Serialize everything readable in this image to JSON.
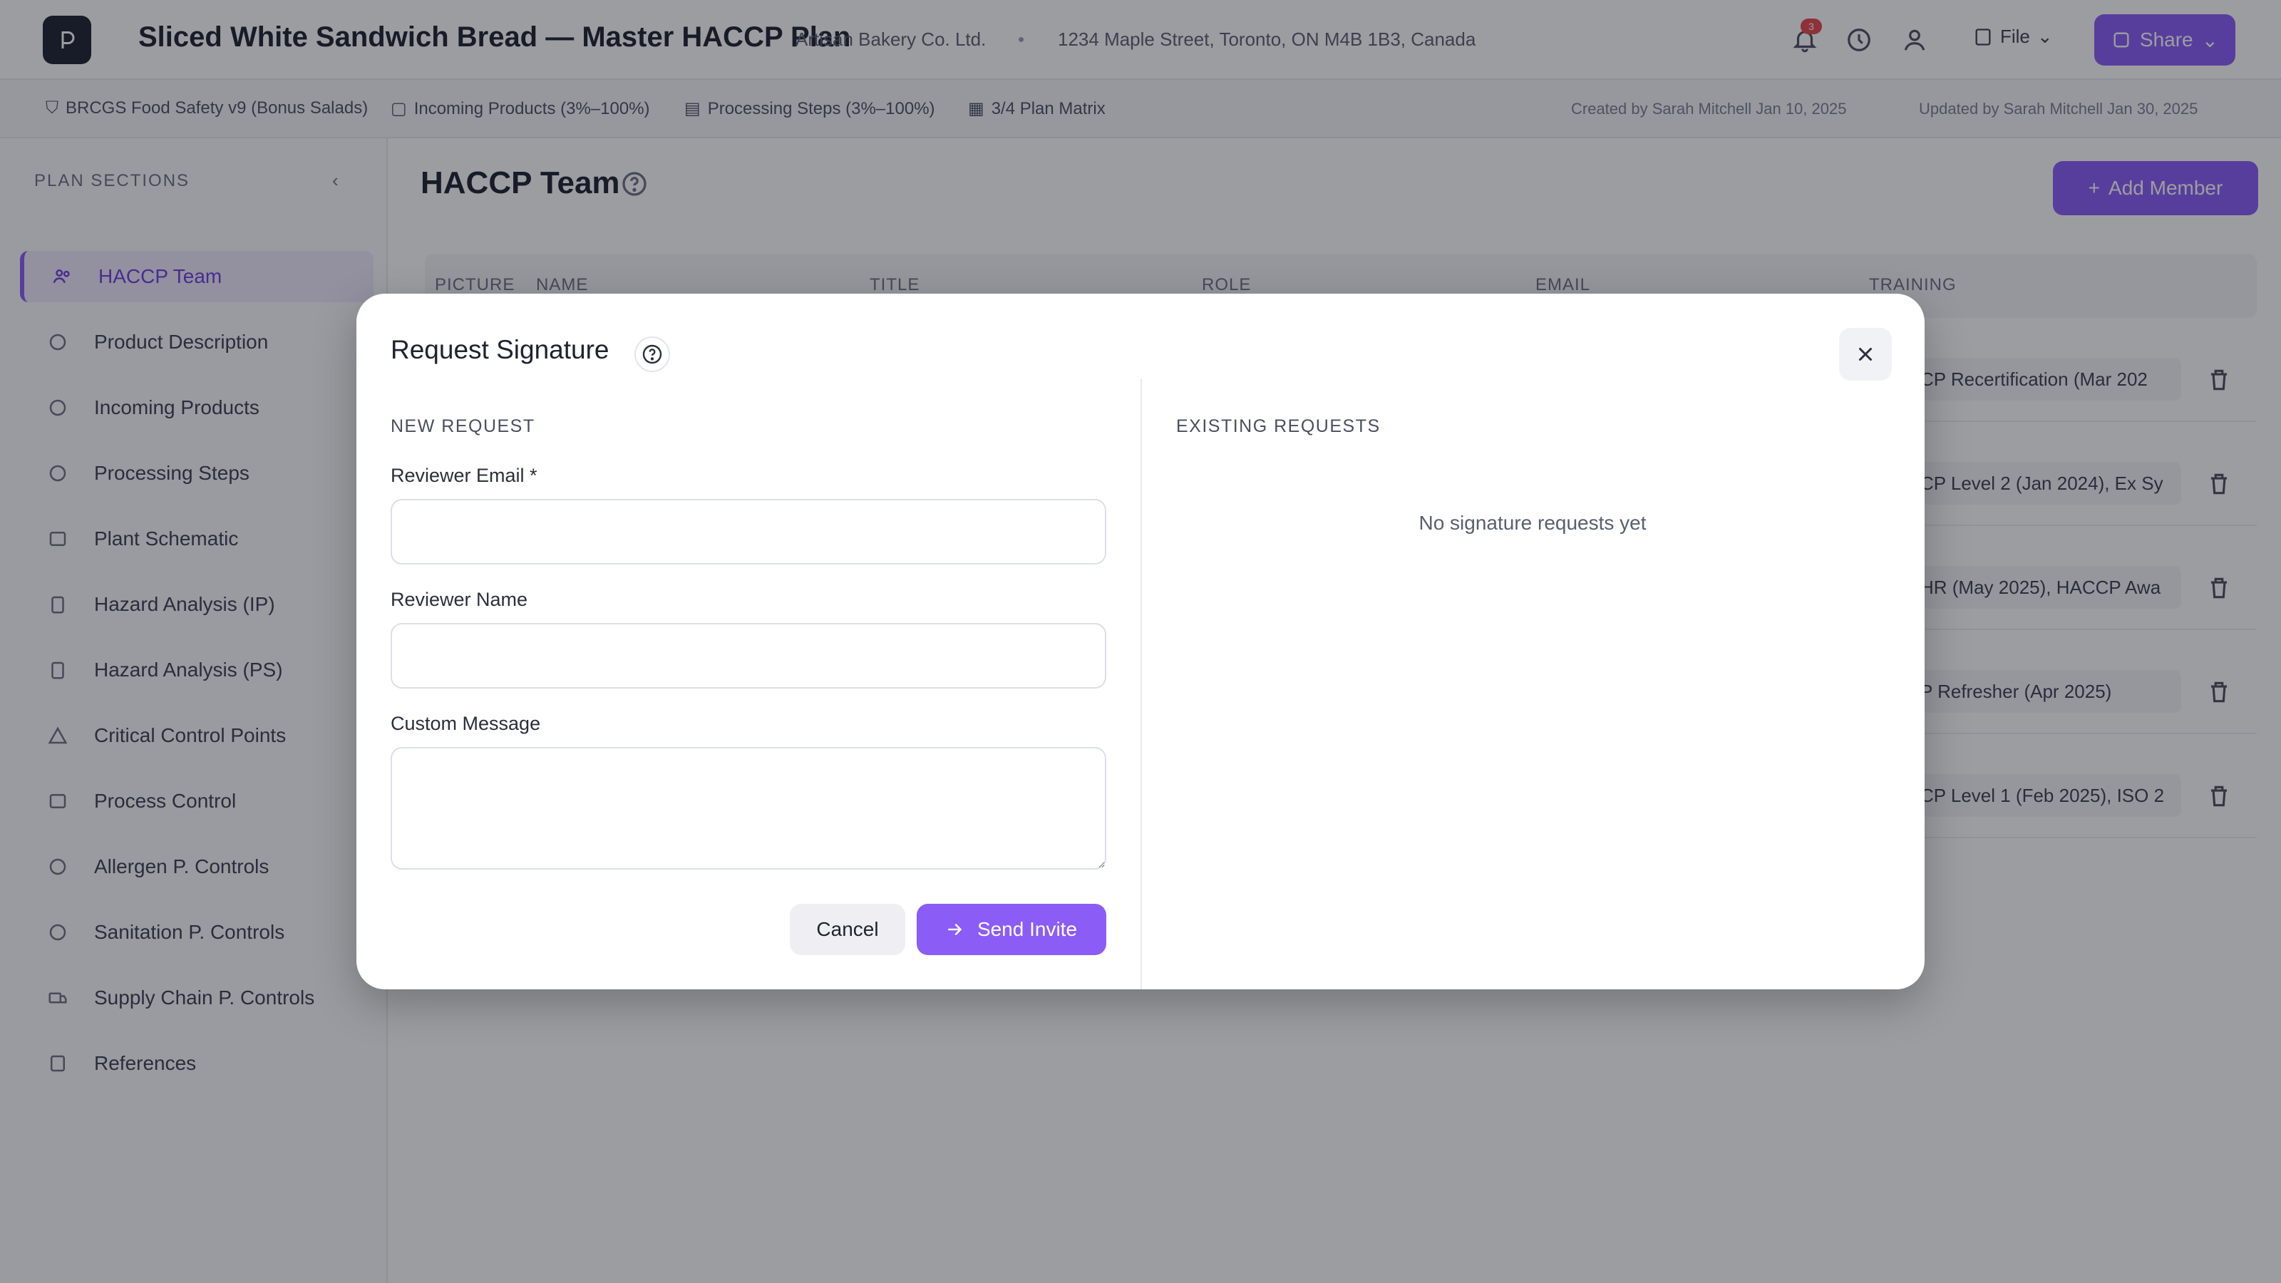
{
  "header": {
    "plan_title": "Sliced White Sandwich Bread — Master HACCP Plan",
    "company": "Artisan Bakery Co. Ltd.",
    "address": "1234 Maple Street, Toronto, ON M4B 1B3, Canada",
    "notification_count": "3",
    "file_menu_label": "File",
    "share_label": "Share"
  },
  "subbar": {
    "chips": [
      "BRCGS Food Safety v9 (Bonus Salads)",
      "Incoming Products (3%–100%)",
      "Processing Steps (3%–100%)",
      "3/4 Plan Matrix"
    ],
    "created": "Created by Sarah Mitchell Jan 10, 2025",
    "updated": "Updated by Sarah Mitchell Jan 30, 2025"
  },
  "sidebar": {
    "heading": "PLAN SECTIONS",
    "items": [
      {
        "label": "HACCP Team",
        "icon": "users-icon"
      },
      {
        "label": "Product Description",
        "icon": "product-icon"
      },
      {
        "label": "Incoming Products",
        "icon": "box-icon"
      },
      {
        "label": "Processing Steps",
        "icon": "steps-icon"
      },
      {
        "label": "Plant Schematic",
        "icon": "map-icon"
      },
      {
        "label": "Hazard Analysis (IP)",
        "icon": "clipboard-icon"
      },
      {
        "label": "Hazard Analysis (PS)",
        "icon": "clipboard-icon"
      },
      {
        "label": "Critical Control Points",
        "icon": "warning-icon"
      },
      {
        "label": "Process Control",
        "icon": "sliders-icon"
      },
      {
        "label": "Allergen P. Controls",
        "icon": "shield-icon"
      },
      {
        "label": "Sanitation P. Controls",
        "icon": "sparkle-icon"
      },
      {
        "label": "Supply Chain P. Controls",
        "icon": "truck-icon"
      },
      {
        "label": "References",
        "icon": "book-icon"
      }
    ]
  },
  "main": {
    "section_title": "HACCP Team",
    "add_member_label": "Add Member",
    "table_headers": [
      "PICTURE",
      "NAME",
      "TITLE",
      "ROLE",
      "EMAIL",
      "TRAINING"
    ],
    "rows": [
      {
        "training": "CP Recertification (Mar 202"
      },
      {
        "training": "CP Level 2 (Jan 2024), Ex Sy"
      },
      {
        "training": "HR (May 2025), HACCP Awa"
      },
      {
        "training": "P Refresher (Apr 2025)"
      },
      {
        "training": "CP Level 1 (Feb 2025), ISO 2"
      }
    ]
  },
  "modal": {
    "title": "Request Signature",
    "new_request_label": "NEW REQUEST",
    "reviewer_email_label": "Reviewer Email *",
    "reviewer_email_value": "",
    "reviewer_name_label": "Reviewer Name",
    "reviewer_name_value": "",
    "custom_message_label": "Custom Message",
    "custom_message_value": "",
    "cancel_label": "Cancel",
    "send_label": "Send Invite",
    "existing_requests_label": "EXISTING REQUESTS",
    "empty_state": "No signature requests yet"
  },
  "colors": {
    "accent": "#8b5cf6",
    "overlay": "rgba(20,22,30,0.42)"
  }
}
